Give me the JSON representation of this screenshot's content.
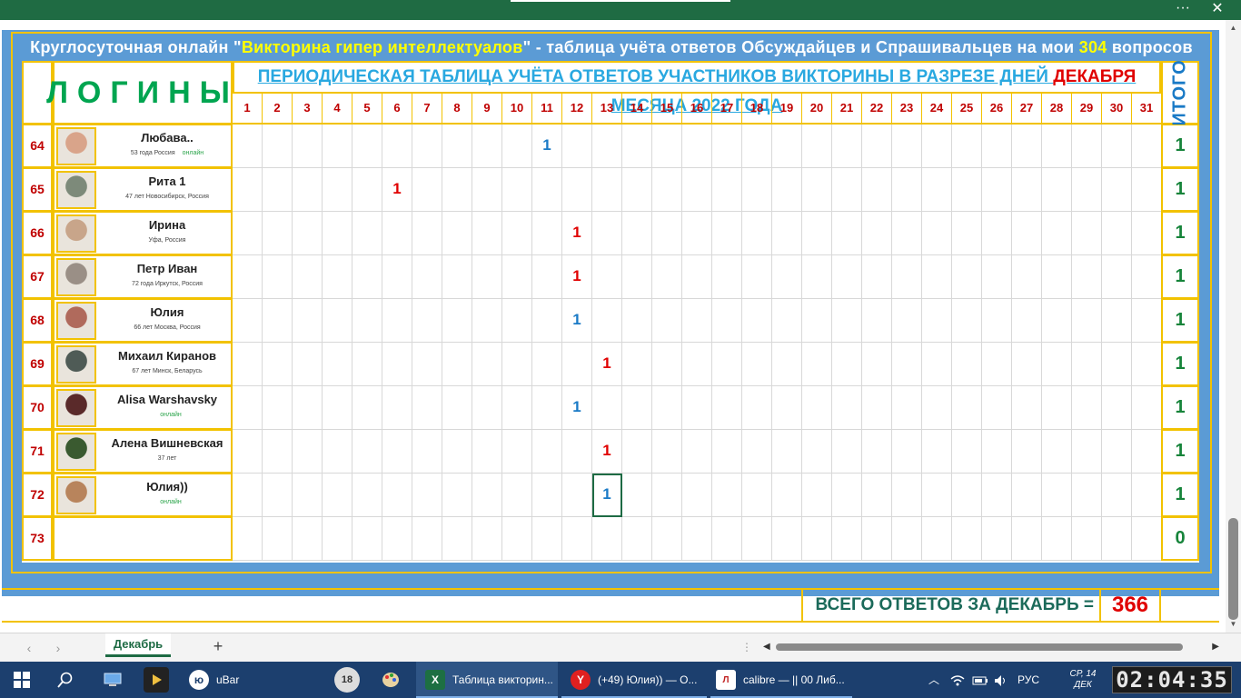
{
  "window": {
    "more_label": "···",
    "close_label": "✕"
  },
  "header": {
    "title_part1": "Круглосуточная онлайн \"",
    "title_quiz": "Викторина гипер интеллектуалов",
    "title_part2": "\" - таблица учёта ответов Обсуждайцев и Спрашивальцев на мои ",
    "title_count": "304",
    "title_part3": " вопросов"
  },
  "table": {
    "logins_label": "ЛОГИНЫ",
    "period_title_part1": "ПЕРИОДИЧЕСКАЯ ТАБЛИЦА УЧЁТА ОТВЕТОВ УЧАСТНИКОВ ВИКТОРИНЫ В РАЗРЕЗЕ  ДНЕЙ ",
    "period_title_month": "ДЕКАБРЯ",
    "period_title_part2": "  МЕСЯЦА  2022  ГОДА",
    "itogo_label": "ИТОГО",
    "days": [
      "1",
      "2",
      "3",
      "4",
      "5",
      "6",
      "7",
      "8",
      "9",
      "10",
      "11",
      "12",
      "13",
      "14",
      "15",
      "16",
      "17",
      "18",
      "19",
      "20",
      "21",
      "22",
      "23",
      "24",
      "25",
      "26",
      "27",
      "28",
      "29",
      "30",
      "31"
    ],
    "rows": [
      {
        "num": "64",
        "name": "Любава..",
        "info": "53 года      Россия",
        "online": "онлайн",
        "day": 11,
        "value": "1",
        "color": "#1a7ac6",
        "total": "1",
        "avatar": "#d9a48a"
      },
      {
        "num": "65",
        "name": "Рита 1",
        "info": "47 лет      Новосибирск, Россия",
        "online": "",
        "day": 6,
        "value": "1",
        "color": "#e00000",
        "total": "1",
        "avatar": "#7d8a7a"
      },
      {
        "num": "66",
        "name": "Ирина",
        "info": "Уфа, Россия",
        "online": "",
        "day": 12,
        "value": "1",
        "color": "#e00000",
        "total": "1",
        "avatar": "#c8a58a"
      },
      {
        "num": "67",
        "name": "Петр Иван",
        "info": "72 года       Иркутск, Россия",
        "online": "",
        "day": 12,
        "value": "1",
        "color": "#e00000",
        "total": "1",
        "avatar": "#9a8f86"
      },
      {
        "num": "68",
        "name": "Юлия",
        "info": "66 лет      Москва, Россия",
        "online": "",
        "day": 12,
        "value": "1",
        "color": "#1a7ac6",
        "total": "1",
        "avatar": "#b06a5c"
      },
      {
        "num": "69",
        "name": "Михаил Киранов",
        "info": "67 лет      Минск, Беларусь",
        "online": "",
        "day": 13,
        "value": "1",
        "color": "#e00000",
        "total": "1",
        "avatar": "#4f5b56"
      },
      {
        "num": "70",
        "name": "Alisa Warshavsky",
        "info": "",
        "online": "онлайн",
        "day": 12,
        "value": "1",
        "color": "#1a7ac6",
        "total": "1",
        "avatar": "#5a2a2a"
      },
      {
        "num": "71",
        "name": "Алена Вишневская",
        "info": "37 лет",
        "online": "",
        "day": 13,
        "value": "1",
        "color": "#e00000",
        "total": "1",
        "avatar": "#3a5a30"
      },
      {
        "num": "72",
        "name": "Юлия))",
        "info": "",
        "online": "онлайн",
        "day": 13,
        "value": "1",
        "color": "#1a7ac6",
        "total": "1",
        "avatar": "#b8845c"
      },
      {
        "num": "73",
        "name": "",
        "info": "",
        "online": "",
        "day": 0,
        "value": "",
        "color": "#000000",
        "total": "0",
        "avatar": ""
      }
    ],
    "selected": {
      "row": 8,
      "day": 13
    }
  },
  "summary": {
    "label": "ВСЕГО ОТВЕТОВ ЗА ДЕКАБРЬ =",
    "value": "366"
  },
  "sheet_tabs": {
    "active": "Декабрь",
    "add": "+",
    "prev": "‹",
    "next": "›",
    "dots": "⋮"
  },
  "taskbar": {
    "apps": [
      {
        "label": "uBar",
        "icon": "ю"
      },
      {
        "label": "Таблица викторин...",
        "icon": "X"
      },
      {
        "label": "(+49) Юлия)) — О...",
        "icon": "Y"
      },
      {
        "label": "calibre — || 00 Либ...",
        "icon": "Л"
      }
    ],
    "tray": {
      "lang": "РУС",
      "date_line1": "СР, 14",
      "date_line2": "ДЕК",
      "time": "02:04:35"
    }
  }
}
